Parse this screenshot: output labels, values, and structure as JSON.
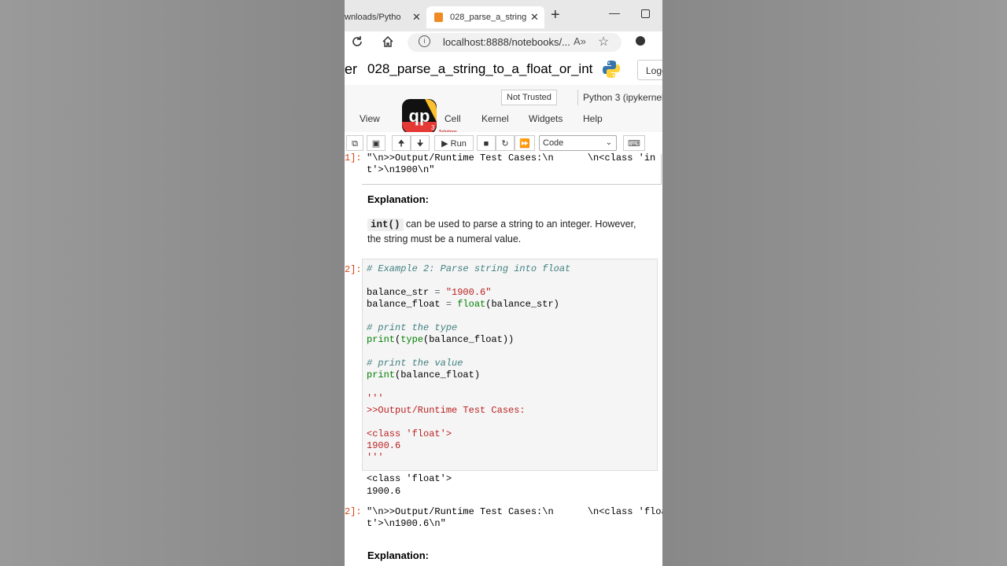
{
  "browser": {
    "tab1_label": "wnloads/Pytho",
    "tab2_label": "028_parse_a_string",
    "close_glyph": "✕",
    "newtab_glyph": "+",
    "url": "localhost:8888/notebooks/...",
    "read_aloud": "A»",
    "favorites_glyph": "☆"
  },
  "notebook": {
    "logo_fragment": "er",
    "title": "028_parse_a_string_to_a_float_or_int",
    "logout_label": "Logo",
    "not_trusted": "Not Trusted",
    "kernel": "Python 3 (ipykernel",
    "menu": {
      "view": "View",
      "cell": "Cell",
      "kernel": "Kernel",
      "widgets": "Widgets",
      "help": "Help"
    },
    "run_label": "Run",
    "cell_type": "Code",
    "watermark": {
      "letters": "qp",
      "sup": "3",
      "sub": "Solutions",
      "tag": "The Hightech Future Here"
    }
  },
  "cells": {
    "out1_prompt": "1]:",
    "out1_text": "\"\\n>>Output/Runtime Test Cases:\\n      \\n<class 'in\nt'>\\n1900\\n\"",
    "explanation_heading": "Explanation:",
    "expl_code": "int()",
    "expl_text": " can be used to parse a string to an integer. However, the string must be a numeral value.",
    "in2_prompt": "2]:",
    "code": {
      "comment1": "# Example 2: Parse string into float",
      "l2a": "balance_str ",
      "l2b": "=",
      "l2c": " \"1900.6\"",
      "l3a": "balance_float ",
      "l3b": "=",
      "l3c": "float",
      "l3d": "(balance_str)",
      "comment2": "# print the type",
      "l5a": "print",
      "l5b": "(",
      "l5c": "type",
      "l5d": "(balance_float))",
      "comment3": "# print the value",
      "l7a": "print",
      "l7b": "(balance_float)",
      "doc1": "'''",
      "doc2": ">>Output/Runtime Test Cases:",
      "doc3": "<class 'float'>",
      "doc4": "1900.6",
      "doc5": "'''"
    },
    "stdout1": "<class 'float'>",
    "stdout2": "1900.6",
    "out2_prompt": "2]:",
    "out2_text": "\"\\n>>Output/Runtime Test Cases:\\n      \\n<class 'floa\nt'>\\n1900.6\\n\"",
    "explanation_heading2": "Explanation:"
  }
}
